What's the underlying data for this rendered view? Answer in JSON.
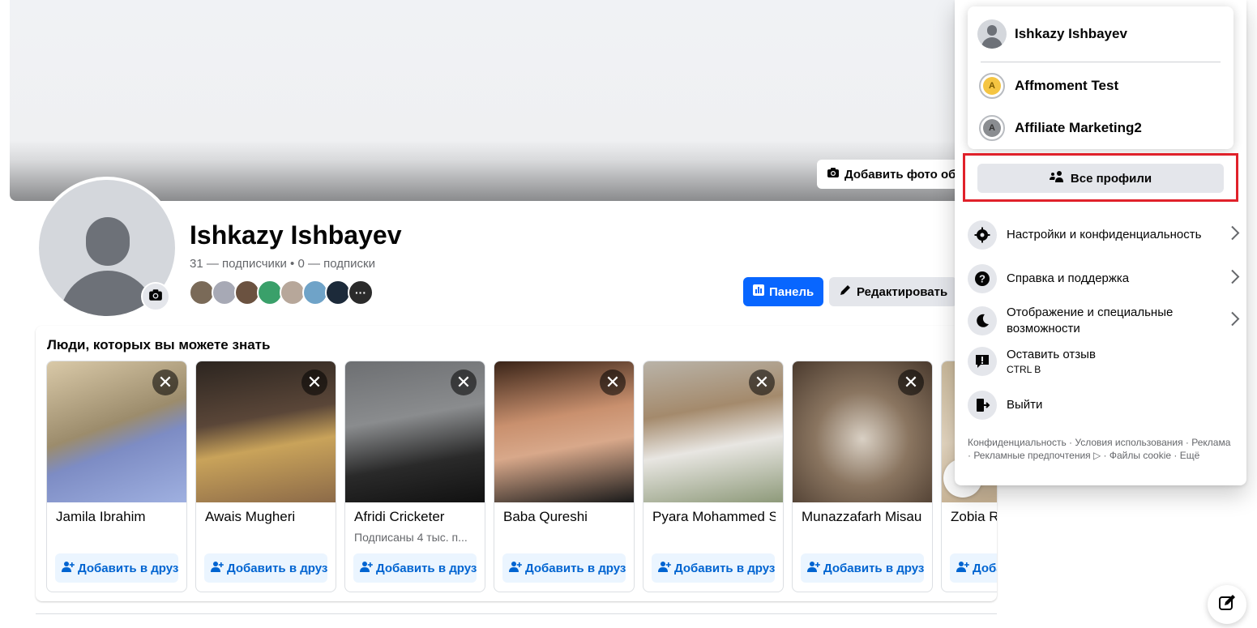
{
  "cover": {
    "add_photo_label": "Добавить фото обл"
  },
  "profile": {
    "name": "Ishkazy Ishbayev",
    "stats": "31 — подписчики • 0 — подписки",
    "panel_label": "Панель",
    "edit_label": "Редактировать"
  },
  "pymk": {
    "title": "Люди, которых вы можете знать",
    "cards": [
      {
        "name": "Jamila Ibrahim",
        "meta": "",
        "add": "Добавить в друз..."
      },
      {
        "name": "Awais Mugheri",
        "meta": "",
        "add": "Добавить в друз..."
      },
      {
        "name": "Afridi Cricketer",
        "meta": "Подписаны 4 тыс. п...",
        "add": "Добавить в друз..."
      },
      {
        "name": "Baba Qureshi",
        "meta": "",
        "add": "Добавить в друз..."
      },
      {
        "name": "Pyara Mohammed S",
        "meta": "",
        "add": "Добавить в друз..."
      },
      {
        "name": "Munazzafarh Misau",
        "meta": "",
        "add": "Добавить в друз..."
      },
      {
        "name": "Zobia R",
        "meta": "",
        "add": "Доба"
      }
    ]
  },
  "menu": {
    "accounts": [
      {
        "name": "Ishkazy Ishbayev"
      },
      {
        "name": "Affmoment Test",
        "letter": "A",
        "color": "#f5c542"
      },
      {
        "name": "Affiliate Marketing2",
        "letter": "A",
        "color": "#8a8d91"
      }
    ],
    "all_profiles_label": "Все профили",
    "items": [
      {
        "label": "Настройки и конфиденциальность"
      },
      {
        "label": "Справка и поддержка"
      },
      {
        "label": "Отображение и специальные возможности"
      },
      {
        "label": "Оставить отзыв",
        "sub": "CTRL B"
      },
      {
        "label": "Выйти"
      }
    ],
    "footer": "Конфиденциальность · Условия использования · Реклама · Рекламные предпочтения ▷ · Файлы cookie · Ещё"
  },
  "colors": {
    "primary": "#0866ff",
    "highlight": "#e0212a",
    "add_text": "#0064d1"
  }
}
